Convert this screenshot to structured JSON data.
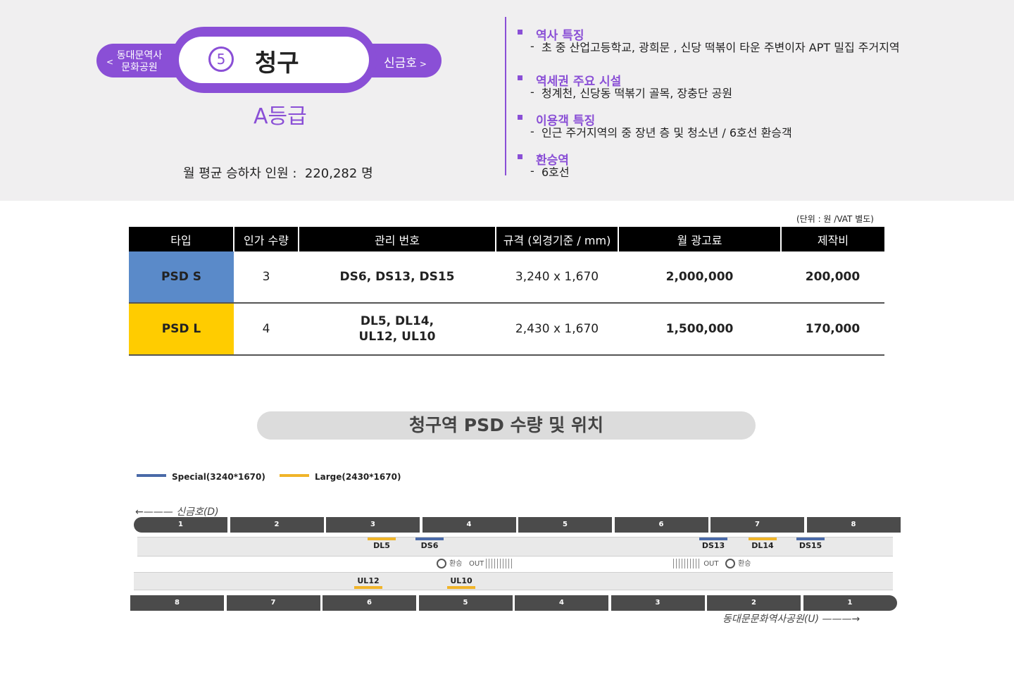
{
  "station": {
    "line_number": "5",
    "name": "청구",
    "prev_station": "동대문역사\n문화공원",
    "next_station": "신금호",
    "grade": "A등급",
    "monthly_riders_label": "월 평균 승하차 인원 :",
    "monthly_riders_value": "220,282",
    "monthly_riders_unit": "명"
  },
  "features": [
    {
      "heading": "역사 특징",
      "detail": "초  중 산업고등학교, 광희문 , 신당 떡볶이 타운 주변이자 APT 밀집 주거지역"
    },
    {
      "heading": "역세권 주요 시설",
      "detail": "청계천, 신당동 떡볶기 골목, 장충단 공원"
    },
    {
      "heading": "이용객 특징",
      "detail": "인근 주거지역의 중 장년 층 및 청소년 / 6호선 환승객"
    },
    {
      "heading": "환승역",
      "detail": "6호선"
    }
  ],
  "table": {
    "unit_note": "(단위 : 원 /VAT 별도)",
    "headers": [
      "타입",
      "인가 수량",
      "관리 번호",
      "규격 (외경기준 / mm)",
      "월 광고료",
      "제작비"
    ],
    "rows": [
      {
        "type": "PSD S",
        "type_color": "#5a8ac9",
        "qty": "3",
        "codes": "DS6, DS13, DS15",
        "size": "3,240 x 1,670",
        "fee": "2,000,000",
        "cost": "200,000"
      },
      {
        "type": "PSD L",
        "type_color": "#ffcc00",
        "qty": "4",
        "codes": "DL5, DL14,\nUL12, UL10",
        "size": "2,430 x 1,670",
        "fee": "1,500,000",
        "cost": "170,000"
      }
    ]
  },
  "section_title": "청구역 PSD 수량 및 위치",
  "legend": [
    {
      "label": "Special(3240*1670)",
      "color": "#4a6aa8"
    },
    {
      "label": "Large(2430*1670)",
      "color": "#f0b429"
    }
  ],
  "diagram": {
    "dir_top": "신금호(D)",
    "dir_bottom": "동대문문화역사공원(U)",
    "top_cars": [
      "1",
      "2",
      "3",
      "4",
      "5",
      "6",
      "7",
      "8"
    ],
    "bottom_cars": [
      "8",
      "7",
      "6",
      "5",
      "4",
      "3",
      "2",
      "1"
    ],
    "top_markers": [
      {
        "label": "DL5",
        "kind": "large"
      },
      {
        "label": "DS6",
        "kind": "special"
      },
      {
        "label": "DS13",
        "kind": "special"
      },
      {
        "label": "DL14",
        "kind": "large"
      },
      {
        "label": "DS15",
        "kind": "special"
      }
    ],
    "bottom_markers": [
      {
        "label": "UL12",
        "kind": "large"
      },
      {
        "label": "UL10",
        "kind": "large"
      }
    ],
    "transfer_label": "환승",
    "out_label": "OUT"
  }
}
